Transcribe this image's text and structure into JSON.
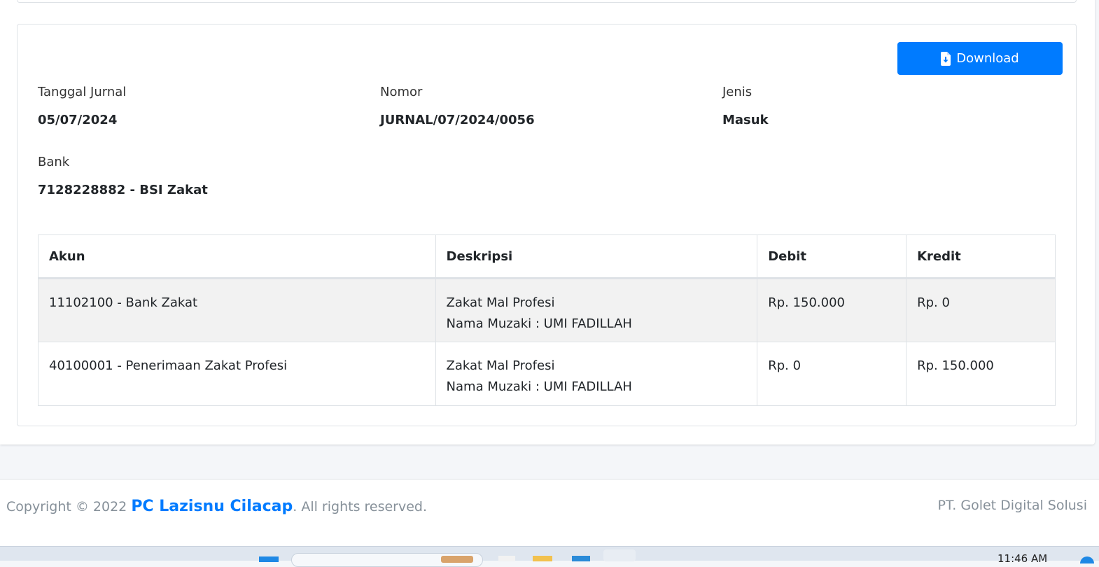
{
  "actions": {
    "download_label": "Download",
    "download_icon": "file-download-icon"
  },
  "fields": {
    "tanggal": {
      "label": "Tanggal Jurnal",
      "value": "05/07/2024"
    },
    "nomor": {
      "label": "Nomor",
      "value": "JURNAL/07/2024/0056"
    },
    "jenis": {
      "label": "Jenis",
      "value": "Masuk"
    },
    "bank": {
      "label": "Bank",
      "value": "7128228882 - BSI Zakat"
    }
  },
  "table": {
    "headers": [
      "Akun",
      "Deskripsi",
      "Debit",
      "Kredit"
    ],
    "rows": [
      {
        "akun": "11102100 - Bank Zakat",
        "deskripsi_1": "Zakat Mal Profesi",
        "deskripsi_2": "Nama Muzaki : UMI FADILLAH",
        "debit": "Rp. 150.000",
        "kredit": "Rp. 0"
      },
      {
        "akun": "40100001 - Penerimaan Zakat Profesi",
        "deskripsi_1": "Zakat Mal Profesi",
        "deskripsi_2": "Nama Muzaki : UMI FADILLAH",
        "debit": "Rp. 0",
        "kredit": "Rp. 150.000"
      }
    ]
  },
  "footer": {
    "copyright_prefix": "Copyright © 2022 ",
    "brand": "PC Lazisnu Cilacap",
    "copyright_suffix": ". All rights reserved.",
    "right_text": "PT. Golet Digital Solusi"
  },
  "taskbar": {
    "time": "11:46 AM"
  },
  "colors": {
    "accent": "#007bff",
    "footer_text": "#869099",
    "row_stripe": "#f2f2f2"
  }
}
